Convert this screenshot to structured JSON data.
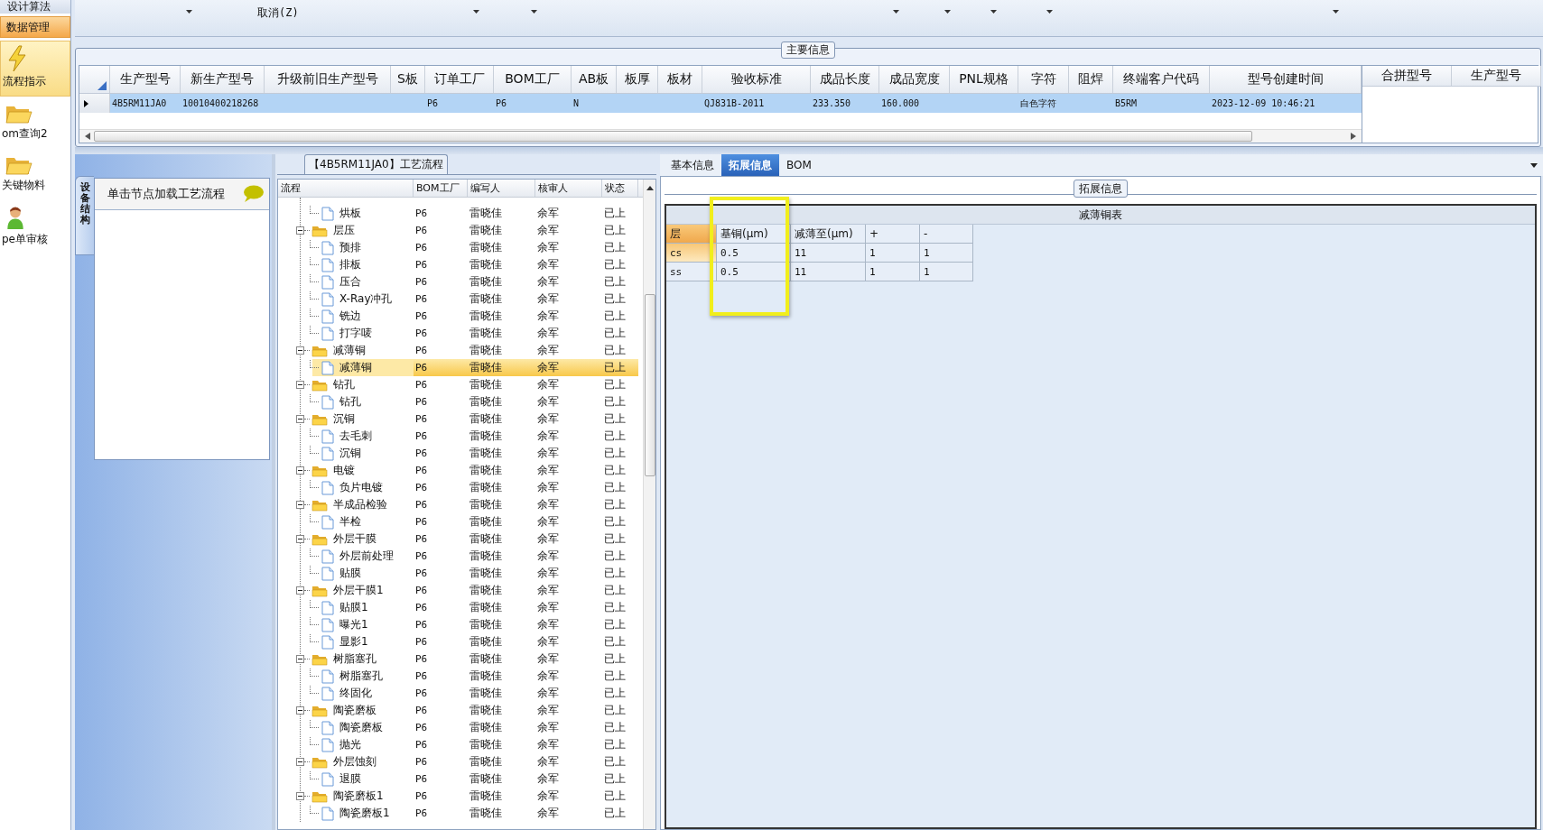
{
  "sidebar": {
    "top_item": "设计算法",
    "section": "数据管理",
    "items": [
      {
        "label": "流程指示",
        "kind": "bolt",
        "selected": true
      },
      {
        "label": "om查询2",
        "kind": "folder",
        "selected": false
      },
      {
        "label": "关键物料",
        "kind": "folder",
        "selected": false
      },
      {
        "label": "pe单审核",
        "kind": "person",
        "selected": false
      }
    ]
  },
  "toolbar": {
    "cancel": "取消(Z)"
  },
  "main_info": {
    "title": "主要信息",
    "columns": [
      "生产型号",
      "新生产型号",
      "升级前旧生产型号",
      "S板",
      "订单工厂",
      "BOM工厂",
      "AB板",
      "板厚",
      "板材",
      "验收标准",
      "成品长度",
      "成品宽度",
      "PNL规格",
      "字符",
      "阻焊",
      "终端客户代码",
      "型号创建时间"
    ],
    "rows": [
      {
        "selected": true,
        "cells": [
          "4B5RM11JA0",
          "10010400218268",
          null,
          null,
          "P6",
          "P6",
          "N",
          null,
          null,
          "QJ831B-2011",
          "233.350",
          "160.000",
          null,
          "白色字符",
          null,
          "B5RM",
          "2023-12-09 10:46:21"
        ]
      }
    ],
    "side_columns": [
      "合拼型号",
      "生产型号"
    ]
  },
  "process": {
    "title": "【4B5RM11JA0】工艺流程",
    "side_tab": "设备结构",
    "hint": "单击节点加载工艺流程",
    "columns": [
      "流程",
      "BOM工厂",
      "编写人",
      "核审人",
      "状态"
    ],
    "tree": [
      {
        "label": "烘板",
        "kind": "file",
        "selected": false,
        "bom": "P6",
        "writer": "雷晓佳",
        "reviewer": "余军",
        "status": "已上"
      },
      {
        "label": "层压",
        "kind": "folder",
        "expanded": true,
        "selected": false,
        "bom": "P6",
        "writer": "雷晓佳",
        "reviewer": "余军",
        "status": "已上",
        "children": [
          {
            "label": "预排",
            "kind": "file",
            "selected": false,
            "bom": "P6",
            "writer": "雷晓佳",
            "reviewer": "余军",
            "status": "已上"
          },
          {
            "label": "排板",
            "kind": "file",
            "selected": false,
            "bom": "P6",
            "writer": "雷晓佳",
            "reviewer": "余军",
            "status": "已上"
          },
          {
            "label": "压合",
            "kind": "file",
            "selected": false,
            "bom": "P6",
            "writer": "雷晓佳",
            "reviewer": "余军",
            "status": "已上"
          },
          {
            "label": "X-Ray冲孔",
            "kind": "file",
            "selected": false,
            "bom": "P6",
            "writer": "雷晓佳",
            "reviewer": "余军",
            "status": "已上"
          },
          {
            "label": "铣边",
            "kind": "file",
            "selected": false,
            "bom": "P6",
            "writer": "雷晓佳",
            "reviewer": "余军",
            "status": "已上"
          },
          {
            "label": "打字唛",
            "kind": "file",
            "selected": false,
            "bom": "P6",
            "writer": "雷晓佳",
            "reviewer": "余军",
            "status": "已上"
          }
        ]
      },
      {
        "label": "减薄铜",
        "kind": "folder",
        "expanded": true,
        "selected": false,
        "bom": "P6",
        "writer": "雷晓佳",
        "reviewer": "余军",
        "status": "已上",
        "children": [
          {
            "label": "减薄铜",
            "kind": "file",
            "selected": true,
            "bom": "P6",
            "writer": "雷晓佳",
            "reviewer": "余军",
            "status": "已上"
          }
        ]
      },
      {
        "label": "钻孔",
        "kind": "folder",
        "expanded": true,
        "selected": false,
        "bom": "P6",
        "writer": "雷晓佳",
        "reviewer": "余军",
        "status": "已上",
        "children": [
          {
            "label": "钻孔",
            "kind": "file",
            "selected": false,
            "bom": "P6",
            "writer": "雷晓佳",
            "reviewer": "余军",
            "status": "已上"
          }
        ]
      },
      {
        "label": "沉铜",
        "kind": "folder",
        "expanded": true,
        "selected": false,
        "bom": "P6",
        "writer": "雷晓佳",
        "reviewer": "余军",
        "status": "已上",
        "children": [
          {
            "label": "去毛刺",
            "kind": "file",
            "selected": false,
            "bom": "P6",
            "writer": "雷晓佳",
            "reviewer": "余军",
            "status": "已上"
          },
          {
            "label": "沉铜",
            "kind": "file",
            "selected": false,
            "bom": "P6",
            "writer": "雷晓佳",
            "reviewer": "余军",
            "status": "已上"
          }
        ]
      },
      {
        "label": "电镀",
        "kind": "folder",
        "expanded": true,
        "selected": false,
        "bom": "P6",
        "writer": "雷晓佳",
        "reviewer": "余军",
        "status": "已上",
        "children": [
          {
            "label": "负片电镀",
            "kind": "file",
            "selected": false,
            "bom": "P6",
            "writer": "雷晓佳",
            "reviewer": "余军",
            "status": "已上"
          }
        ]
      },
      {
        "label": "半成品检验",
        "kind": "folder",
        "expanded": true,
        "selected": false,
        "bom": "P6",
        "writer": "雷晓佳",
        "reviewer": "余军",
        "status": "已上",
        "children": [
          {
            "label": "半检",
            "kind": "file",
            "selected": false,
            "bom": "P6",
            "writer": "雷晓佳",
            "reviewer": "余军",
            "status": "已上"
          }
        ]
      },
      {
        "label": "外层干膜",
        "kind": "folder",
        "expanded": true,
        "selected": false,
        "bom": "P6",
        "writer": "雷晓佳",
        "reviewer": "余军",
        "status": "已上",
        "children": [
          {
            "label": "外层前处理",
            "kind": "file",
            "selected": false,
            "bom": "P6",
            "writer": "雷晓佳",
            "reviewer": "余军",
            "status": "已上"
          },
          {
            "label": "贴膜",
            "kind": "file",
            "selected": false,
            "bom": "P6",
            "writer": "雷晓佳",
            "reviewer": "余军",
            "status": "已上"
          }
        ]
      },
      {
        "label": "外层干膜1",
        "kind": "folder",
        "expanded": true,
        "selected": false,
        "bom": "P6",
        "writer": "雷晓佳",
        "reviewer": "余军",
        "status": "已上",
        "children": [
          {
            "label": "贴膜1",
            "kind": "file",
            "selected": false,
            "bom": "P6",
            "writer": "雷晓佳",
            "reviewer": "余军",
            "status": "已上"
          },
          {
            "label": "曝光1",
            "kind": "file",
            "selected": false,
            "bom": "P6",
            "writer": "雷晓佳",
            "reviewer": "余军",
            "status": "已上"
          },
          {
            "label": "显影1",
            "kind": "file",
            "selected": false,
            "bom": "P6",
            "writer": "雷晓佳",
            "reviewer": "余军",
            "status": "已上"
          }
        ]
      },
      {
        "label": "树脂塞孔",
        "kind": "folder",
        "expanded": true,
        "selected": false,
        "bom": "P6",
        "writer": "雷晓佳",
        "reviewer": "余军",
        "status": "已上",
        "children": [
          {
            "label": "树脂塞孔",
            "kind": "file",
            "selected": false,
            "bom": "P6",
            "writer": "雷晓佳",
            "reviewer": "余军",
            "status": "已上"
          },
          {
            "label": "终固化",
            "kind": "file",
            "selected": false,
            "bom": "P6",
            "writer": "雷晓佳",
            "reviewer": "余军",
            "status": "已上"
          }
        ]
      },
      {
        "label": "陶瓷磨板",
        "kind": "folder",
        "expanded": true,
        "selected": false,
        "bom": "P6",
        "writer": "雷晓佳",
        "reviewer": "余军",
        "status": "已上",
        "children": [
          {
            "label": "陶瓷磨板",
            "kind": "file",
            "selected": false,
            "bom": "P6",
            "writer": "雷晓佳",
            "reviewer": "余军",
            "status": "已上"
          },
          {
            "label": "抛光",
            "kind": "file",
            "selected": false,
            "bom": "P6",
            "writer": "雷晓佳",
            "reviewer": "余军",
            "status": "已上"
          }
        ]
      },
      {
        "label": "外层蚀刻",
        "kind": "folder",
        "expanded": true,
        "selected": false,
        "bom": "P6",
        "writer": "雷晓佳",
        "reviewer": "余军",
        "status": "已上",
        "children": [
          {
            "label": "退膜",
            "kind": "file",
            "selected": false,
            "bom": "P6",
            "writer": "雷晓佳",
            "reviewer": "余军",
            "status": "已上"
          }
        ]
      },
      {
        "label": "陶瓷磨板1",
        "kind": "folder",
        "expanded": true,
        "selected": false,
        "bom": "P6",
        "writer": "雷晓佳",
        "reviewer": "余军",
        "status": "已上",
        "children": [
          {
            "label": "陶瓷磨板1",
            "kind": "file",
            "selected": false,
            "bom": "P6",
            "writer": "雷晓佳",
            "reviewer": "余军",
            "status": "已上"
          }
        ]
      }
    ]
  },
  "details": {
    "tabs": [
      {
        "label": "基本信息",
        "selected": false
      },
      {
        "label": "拓展信息",
        "selected": true
      },
      {
        "label": "BOM",
        "selected": false
      }
    ],
    "group": "拓展信息",
    "table": {
      "title": "减薄铜表",
      "columns": [
        "层",
        "基铜(μm)",
        "减薄至(μm)",
        "+",
        "-"
      ],
      "rows": [
        {
          "selected": true,
          "cells": [
            "cs",
            "0.5",
            "11",
            "1",
            "1"
          ]
        },
        {
          "selected": false,
          "cells": [
            "ss",
            "0.5",
            "11",
            "1",
            "1"
          ]
        }
      ]
    }
  }
}
